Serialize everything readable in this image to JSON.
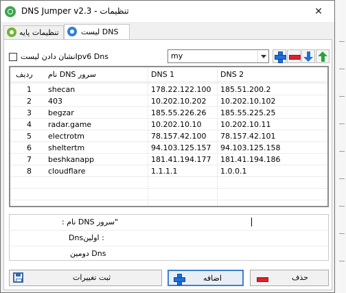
{
  "window": {
    "title": "DNS Jumper v2.3 - تنظیمات",
    "close_glyph": "✕"
  },
  "tabs": [
    {
      "label": "تنظیمات پایه"
    },
    {
      "label": "لیست DNS"
    }
  ],
  "options": {
    "ipv6_label": "نشان دادن لیستIpv6 Dns",
    "ipv6_checked": false,
    "list_selected": "my"
  },
  "table": {
    "headers": [
      "ردیف",
      "نام DNS سرور",
      "DNS 1",
      "DNS 2"
    ],
    "rows": [
      [
        "1",
        "shecan",
        "178.22.122.100",
        "185.51.200.2"
      ],
      [
        "2",
        "403",
        "10.202.10.202",
        "10.202.10.102"
      ],
      [
        "3",
        "begzar",
        "185.55.226.26",
        "185.55.225.25"
      ],
      [
        "4",
        "radar.game",
        "10.202.10.10",
        "10.202.10.11"
      ],
      [
        "5",
        "electrotm",
        "78.157.42.100",
        "78.157.42.101"
      ],
      [
        "6",
        "sheltertm",
        "94.103.125.157",
        "94.103.125.158"
      ],
      [
        "7",
        "beshkanapp",
        "181.41.194.177",
        "181.41.194.186"
      ],
      [
        "8",
        "cloudflare",
        "1.1.1.1",
        "1.0.0.1"
      ]
    ]
  },
  "details": {
    "server_name_label": ": نام DNS سرور\"",
    "primary_label": "Dnsاولین :",
    "secondary_label": "دومین Dns"
  },
  "buttons": {
    "save_label": "ثبت تغییرات",
    "add_label": "اضافه",
    "delete_label": "حذف"
  },
  "colors": {
    "accent_blue": "#1e6fd9",
    "delete_red": "#e0202c",
    "up_green": "#2aa438",
    "base_tab_green": "#6fb532"
  }
}
